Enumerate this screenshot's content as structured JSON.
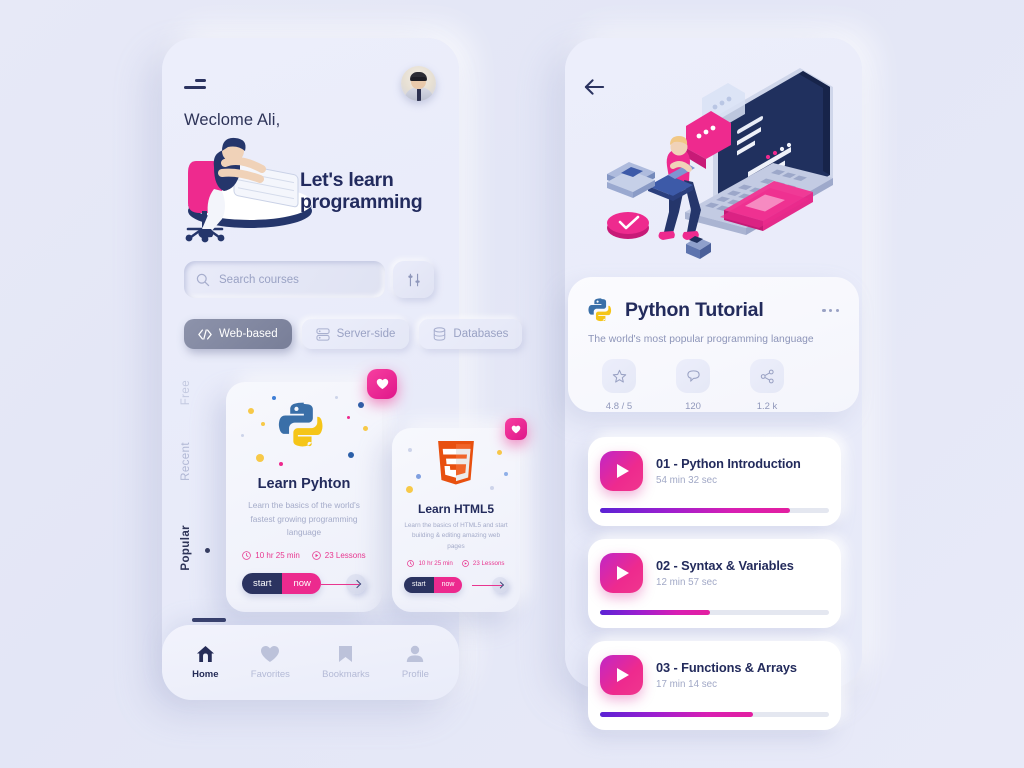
{
  "theme": {
    "bg": "#e4e7f6",
    "accent_pink": "#ec2a8e",
    "accent_navy": "#232b5c",
    "muted": "#a1a8c6"
  },
  "left_screen": {
    "menu_icon": "hamburger-icon",
    "avatar_alt": "user-avatar",
    "welcome_text": "Weclome Ali,",
    "hero_title": "Let's learn\nprogramming",
    "hero_title_line1": "Let's learn",
    "hero_title_line2": "programming",
    "search": {
      "placeholder": "Search courses",
      "value": "",
      "icon": "search-icon"
    },
    "filter_button": {
      "icon": "sliders-icon",
      "label": ""
    },
    "chips": [
      {
        "label": "Web-based",
        "icon": "code-icon",
        "active": true
      },
      {
        "label": "Server-side",
        "icon": "server-icon",
        "active": false
      },
      {
        "label": "Databases",
        "icon": "database-icon",
        "active": false
      }
    ],
    "side_filters": [
      {
        "label": "Free",
        "active": false
      },
      {
        "label": "Recent",
        "active": false
      },
      {
        "label": "Popular",
        "active": true
      }
    ],
    "cards": [
      {
        "id": "python",
        "title": "Learn Pyhton",
        "description": "Learn the basics of  the world's fastest  growing  programming  language",
        "duration": "10 hr 25 min",
        "lessons": "23 Lessons",
        "btn_start": "start",
        "btn_now": "now",
        "favorite": true,
        "logo": "python-logo"
      },
      {
        "id": "html5",
        "title": "Learn HTML5",
        "description": "Learn  the  basics  of  HTML5 and start building & editing amazing web pages",
        "duration": "10 hr 25 min",
        "lessons": "23 Lessons",
        "btn_start": "start",
        "btn_now": "now",
        "favorite": true,
        "logo": "html5-logo"
      }
    ],
    "bottom_nav": [
      {
        "label": "Home",
        "icon": "home-icon",
        "active": true
      },
      {
        "label": "Favorites",
        "icon": "heart-icon",
        "active": false
      },
      {
        "label": "Bookmarks",
        "icon": "bookmark-icon",
        "active": false
      },
      {
        "label": "Profile",
        "icon": "person-icon",
        "active": false
      }
    ]
  },
  "right_screen": {
    "back_icon": "back-arrow-icon",
    "illustration": "isometric-laptop-learning-illustration",
    "detail": {
      "logo": "python-logo",
      "title": "Python Tutorial",
      "subtitle": "The world's most popular programming language",
      "more_icon": "more-dots-icon",
      "stats": [
        {
          "icon": "star-icon",
          "value": "4.8 / 5"
        },
        {
          "icon": "comment-icon",
          "value": "120"
        },
        {
          "icon": "share-icon",
          "value": "1.2 k"
        }
      ]
    },
    "lessons": [
      {
        "title": "01 - Python Introduction",
        "duration": "54 min 32 sec",
        "progress": 83,
        "play_icon": "play-icon"
      },
      {
        "title": "02 - Syntax & Variables",
        "duration": "12 min 57 sec",
        "progress": 48,
        "play_icon": "play-icon"
      },
      {
        "title": "03 - Functions & Arrays",
        "duration": "17 min 14 sec",
        "progress": 67,
        "play_icon": "play-icon"
      }
    ]
  }
}
